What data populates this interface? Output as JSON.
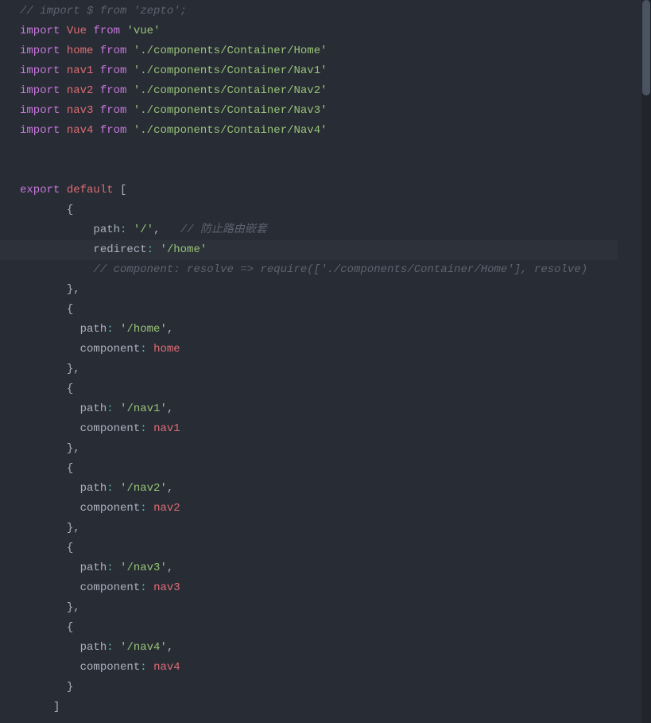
{
  "code": {
    "line1_comment": "// import $ from 'zepto';",
    "import_kw": "import",
    "from_kw": "from",
    "vue_var": "Vue",
    "vue_str": "'vue'",
    "home_var": "home",
    "home_str": "'./components/Container/Home'",
    "nav1_var": "nav1",
    "nav1_str": "'./components/Container/Nav1'",
    "nav2_var": "nav2",
    "nav2_str": "'./components/Container/Nav2'",
    "nav3_var": "nav3",
    "nav3_str": "'./components/Container/Nav3'",
    "nav4_var": "nav4",
    "nav4_str": "'./components/Container/Nav4'",
    "export_kw": "export",
    "default_kw": "default",
    "bracket_open": "[",
    "brace_open": "{",
    "brace_close_comma": "},",
    "brace_close": "}",
    "bracket_close": "]",
    "path_prop": "path",
    "redirect_prop": "redirect",
    "component_prop": "component",
    "colon": ":",
    "comma": ",",
    "root_path": "'/'",
    "root_comment": "// 防止路由嵌套",
    "home_path": "'/home'",
    "resolve_comment": "// component: resolve => require(['./components/Container/Home'], resolve)",
    "nav1_path": "'/nav1'",
    "nav2_path": "'/nav2'",
    "nav3_path": "'/nav3'",
    "nav4_path": "'/nav4'"
  }
}
